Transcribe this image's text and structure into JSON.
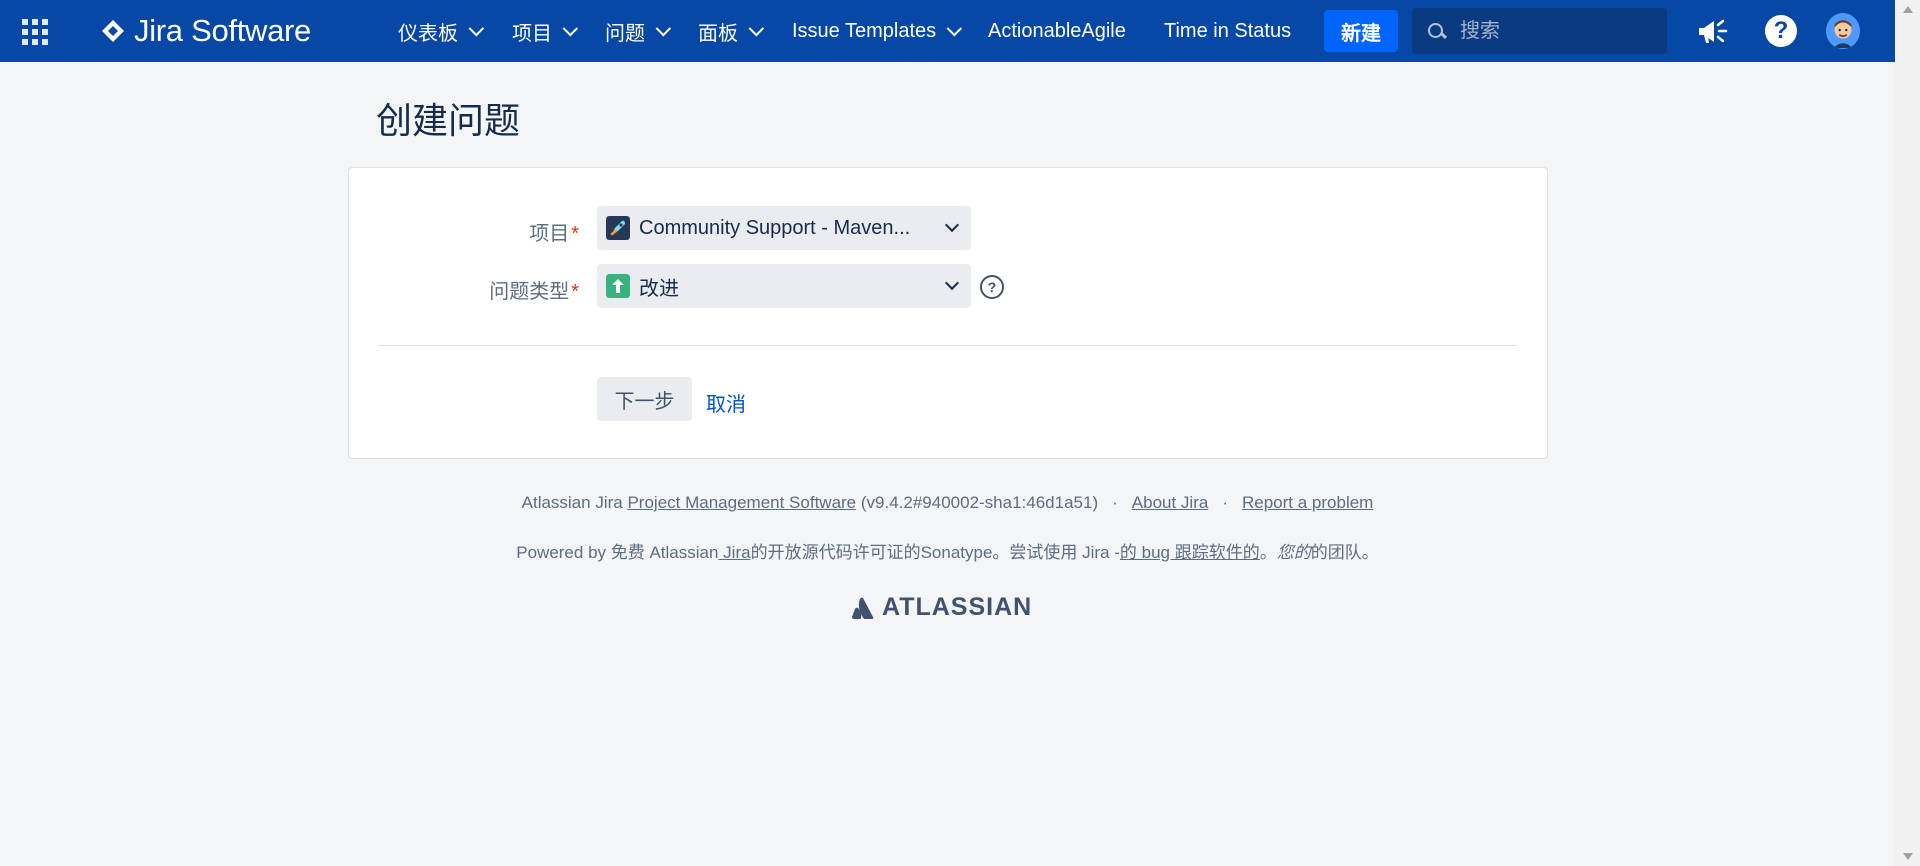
{
  "topnav": {
    "product": "Jira Software",
    "items": [
      {
        "label": "仪表板",
        "dropdown": true
      },
      {
        "label": "项目",
        "dropdown": true
      },
      {
        "label": "问题",
        "dropdown": true
      },
      {
        "label": "面板",
        "dropdown": true
      },
      {
        "label": "Issue Templates",
        "dropdown": true
      },
      {
        "label": "ActionableAgile",
        "dropdown": false
      },
      {
        "label": "Time in Status",
        "dropdown": false
      }
    ],
    "create_label": "新建",
    "search_placeholder": "搜索",
    "help_glyph": "?"
  },
  "page": {
    "title": "创建问题"
  },
  "form": {
    "project_label": "项目",
    "project_value": "Community Support - Maven...",
    "issue_type_label": "问题类型",
    "issue_type_value": "改进",
    "required_mark": "*",
    "help_glyph": "?",
    "next_label": "下一步",
    "cancel_label": "取消"
  },
  "footer": {
    "line1_prefix": "Atlassian Jira ",
    "line1_link": "Project Management Software",
    "line1_version": " (v9.4.2#940002-sha1:46d1a51)",
    "about_link": "About Jira",
    "report_link": "Report a problem",
    "separator": "·",
    "line2_prefix": "Powered by 免费 Atlassian",
    "line2_link1": " Jira",
    "line2_mid": "的开放源代码许可证的Sonatype。尝试使用 Jira -",
    "line2_link2": "的 bug 跟踪软件的",
    "line2_dot": "。",
    "line2_italic": "您的",
    "line2_suffix": "的团队。",
    "brand": "ATLASSIAN"
  },
  "colors": {
    "nav_bg": "#0747a6",
    "create_btn": "#0065ff",
    "page_bg": "#f4f5f7",
    "required": "#de350b",
    "link": "#0052cc",
    "improvement_icon": "#36b37e"
  },
  "icons": {
    "app_switcher": "grid-icon",
    "search": "search-icon",
    "announcement": "megaphone-icon",
    "help": "help-icon",
    "avatar": "user-avatar-icon",
    "project": "rocket-project-icon",
    "issue_type": "improvement-arrow-icon"
  }
}
